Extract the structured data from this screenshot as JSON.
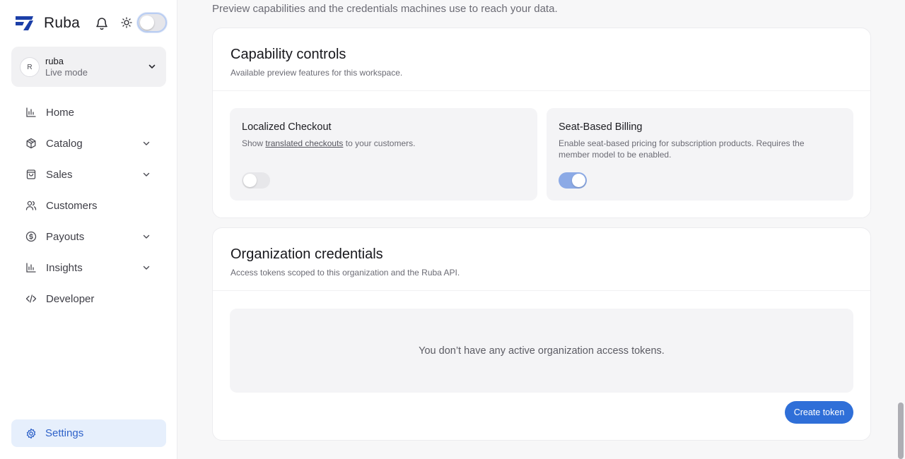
{
  "brand": {
    "name": "Ruba"
  },
  "workspace": {
    "avatar_initial": "R",
    "name": "ruba",
    "mode": "Live mode"
  },
  "sidebar": {
    "items": [
      {
        "label": "Home",
        "icon": "bar-chart-icon",
        "has_chevron": false
      },
      {
        "label": "Catalog",
        "icon": "box-icon",
        "has_chevron": true
      },
      {
        "label": "Sales",
        "icon": "shopping-bag-icon",
        "has_chevron": true
      },
      {
        "label": "Customers",
        "icon": "users-icon",
        "has_chevron": false
      },
      {
        "label": "Payouts",
        "icon": "dollar-circle-icon",
        "has_chevron": true
      },
      {
        "label": "Insights",
        "icon": "bar-chart-icon",
        "has_chevron": true
      },
      {
        "label": "Developer",
        "icon": "code-icon",
        "has_chevron": false
      }
    ],
    "settings": {
      "label": "Settings",
      "icon": "gear-icon",
      "active": true
    }
  },
  "page": {
    "subtitle": "Preview capabilities and the credentials machines use to reach your data."
  },
  "capability_controls": {
    "title": "Capability controls",
    "description": "Available preview features for this workspace.",
    "features": [
      {
        "title": "Localized Checkout",
        "desc_prefix": "Show ",
        "desc_link": "translated checkouts",
        "desc_suffix": " to your customers.",
        "enabled": false
      },
      {
        "title": "Seat-Based Billing",
        "description": "Enable seat-based pricing for subscription products. Requires the member model to be enabled.",
        "enabled": true
      }
    ]
  },
  "credentials": {
    "title": "Organization credentials",
    "description": "Access tokens scoped to this organization and the Ruba API.",
    "empty_message": "You don’t have any active organization access tokens.",
    "create_label": "Create token"
  },
  "colors": {
    "accent": "#2f6fd8",
    "active_nav_bg": "#e6effc",
    "toggle_on": "#8caae6",
    "toggle_off": "#e7e7ea"
  }
}
